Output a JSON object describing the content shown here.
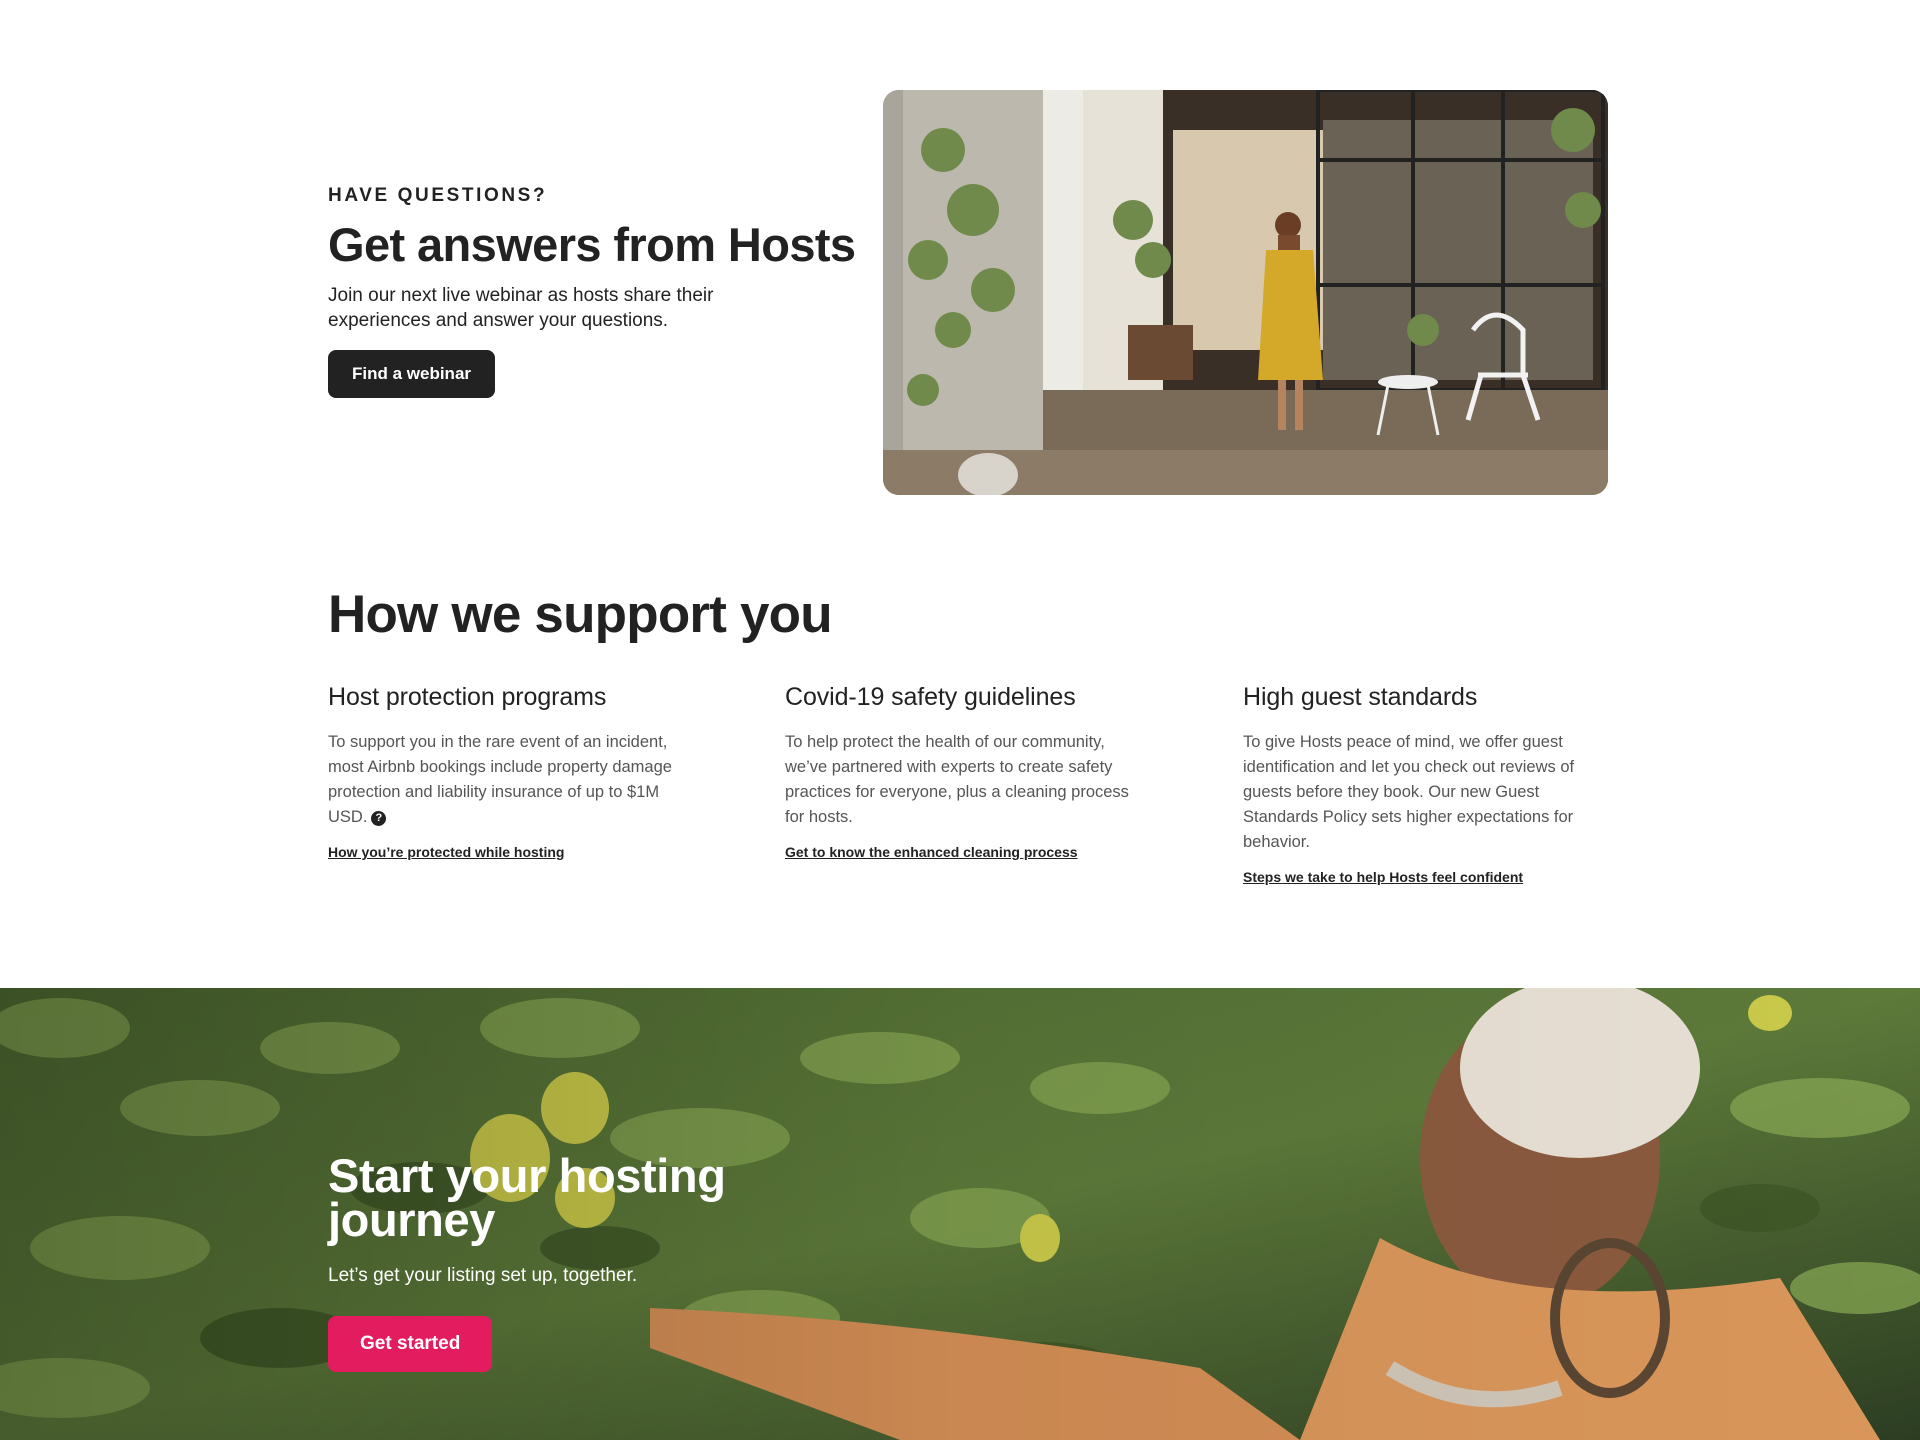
{
  "webinar": {
    "eyebrow": "HAVE QUESTIONS?",
    "title": "Get answers from Hosts",
    "description": "Join our next live webinar as hosts share their experiences and answer your questions.",
    "button_label": "Find a webinar"
  },
  "support": {
    "title": "How we support you",
    "cards": [
      {
        "title": "Host protection programs",
        "description": "To support you in the rare event of an incident, most Airbnb bookings include property damage protection and liability insurance of up to $1M USD.",
        "help_icon": "?",
        "link": "How you’re protected while hosting"
      },
      {
        "title": "Covid-19 safety guidelines",
        "description": "To help protect the health of our community, we’ve partnered with experts to create safety practices for everyone, plus a cleaning process for hosts.",
        "link": "Get to know the enhanced cleaning process"
      },
      {
        "title": "High guest standards",
        "description": "To give Hosts peace of mind, we offer guest identification and let you check out reviews of guests before they book. Our new Guest Standards Policy sets higher expectations for behavior.",
        "link": "Steps we take to help Hosts feel confident"
      }
    ]
  },
  "hero": {
    "title": "Start your hosting journey",
    "subtitle": "Let’s get your listing set up, together.",
    "button_label": "Get started"
  },
  "colors": {
    "primary_dark": "#222222",
    "brand_pink": "#e31c5f",
    "muted_text": "#555555"
  },
  "icons": {
    "help": "question-circle-icon"
  }
}
